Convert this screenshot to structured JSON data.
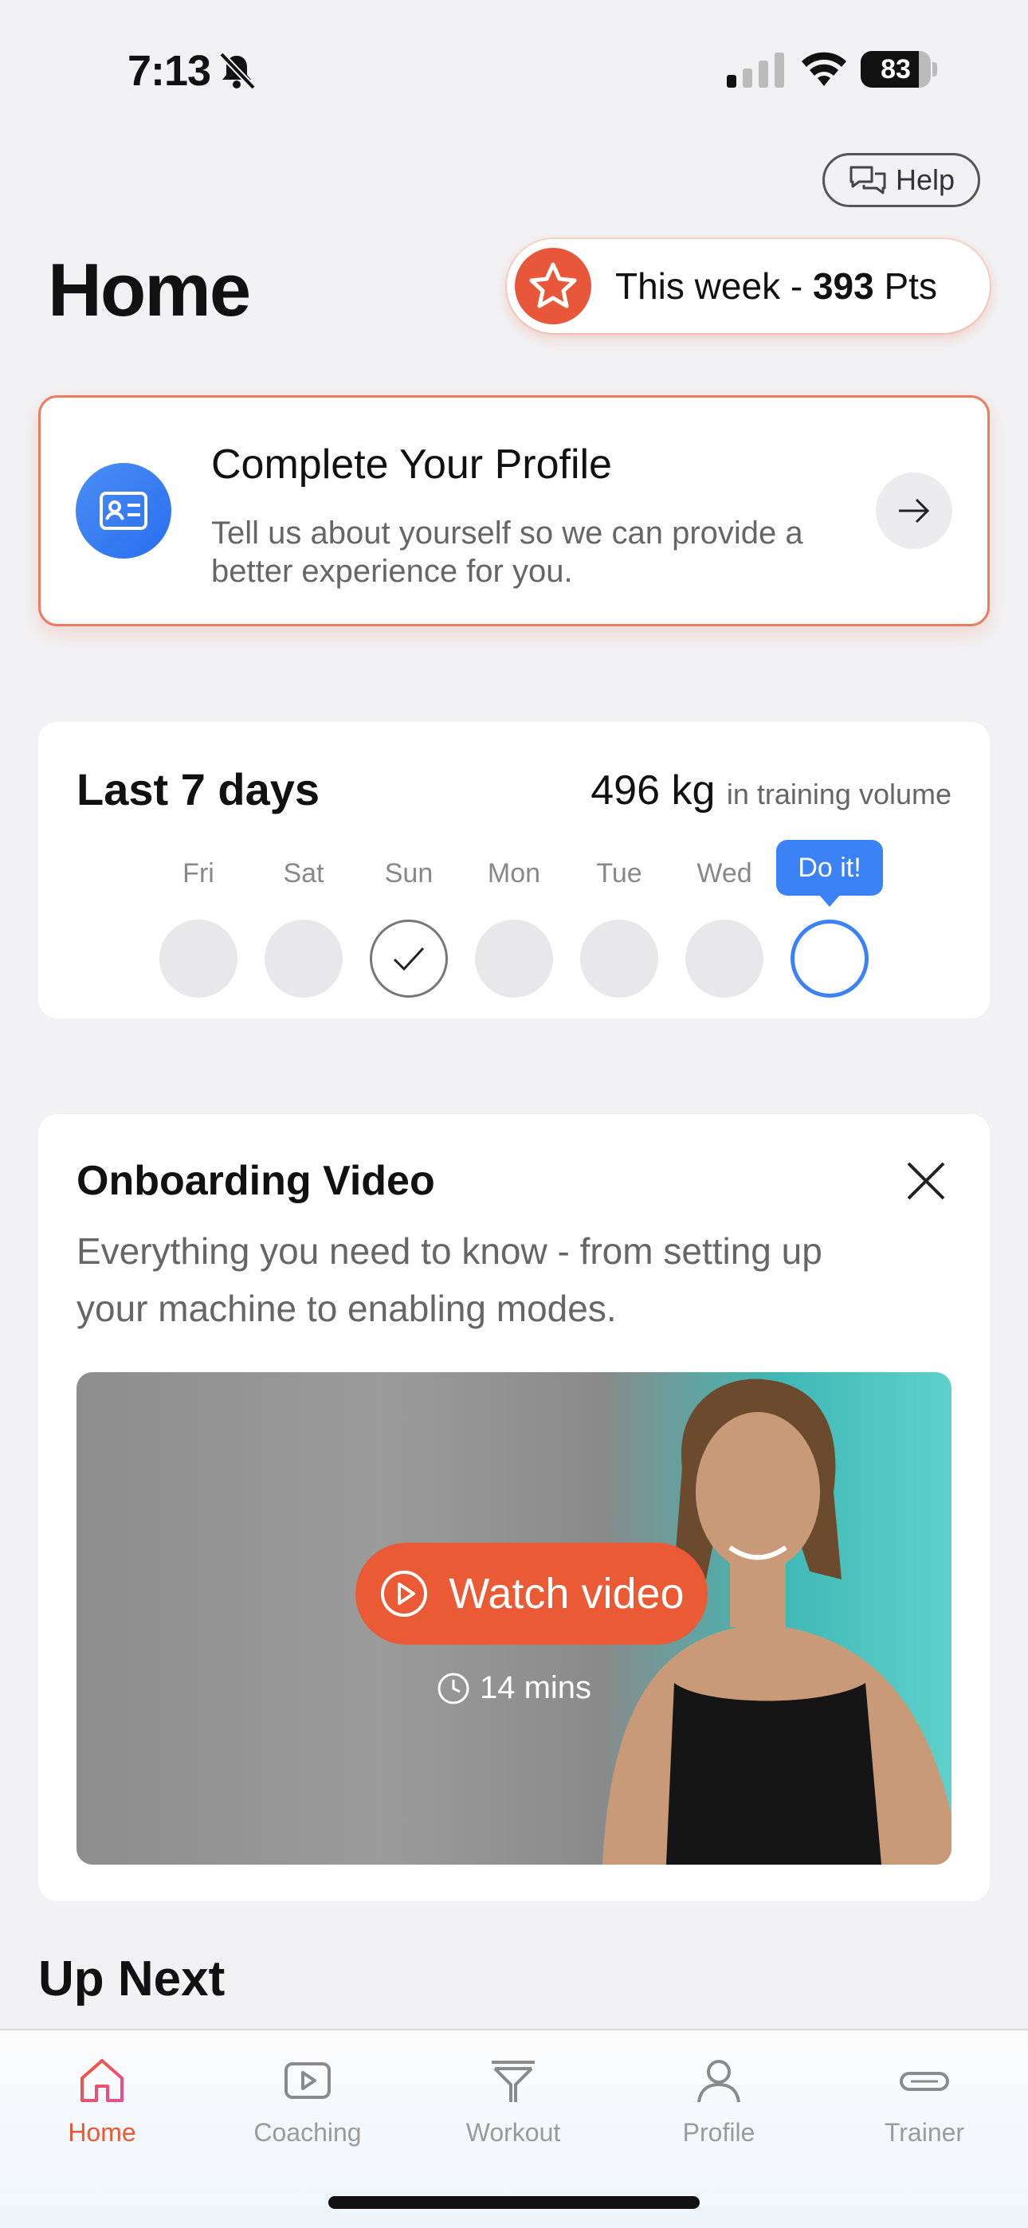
{
  "status_bar": {
    "time": "7:13",
    "battery": "83",
    "battery_level": 0.83
  },
  "header": {
    "help_label": "Help",
    "title": "Home"
  },
  "points": {
    "prefix": "This week - ",
    "value": "393",
    "suffix": " Pts"
  },
  "profile_card": {
    "title": "Complete Your Profile",
    "description": "Tell us about yourself so we can provide a better experience for you."
  },
  "last7": {
    "title": "Last 7 days",
    "volume_value": "496 kg",
    "volume_caption": "in training volume",
    "days": [
      {
        "label": "Fri",
        "state": "empty"
      },
      {
        "label": "Sat",
        "state": "empty"
      },
      {
        "label": "Sun",
        "state": "done"
      },
      {
        "label": "Mon",
        "state": "empty"
      },
      {
        "label": "Tue",
        "state": "empty"
      },
      {
        "label": "Wed",
        "state": "empty"
      },
      {
        "label": "",
        "state": "today"
      }
    ],
    "today_label": "Do it!"
  },
  "onboarding": {
    "title": "Onboarding Video",
    "description": "Everything you need to know - from setting up your machine to enabling modes.",
    "watch_label": "Watch video",
    "duration": "14 mins"
  },
  "up_next": {
    "title": "Up Next"
  },
  "tabbar": {
    "tabs": [
      {
        "label": "Home",
        "icon": "home-icon",
        "active": true
      },
      {
        "label": "Coaching",
        "icon": "play-video-icon",
        "active": false
      },
      {
        "label": "Workout",
        "icon": "cable-machine-icon",
        "active": false
      },
      {
        "label": "Profile",
        "icon": "person-icon",
        "active": false
      },
      {
        "label": "Trainer",
        "icon": "trainer-device-icon",
        "active": false
      }
    ]
  },
  "colors": {
    "accent": "#ea5a35",
    "blue": "#3b82f6",
    "background": "#f2f2f4"
  }
}
